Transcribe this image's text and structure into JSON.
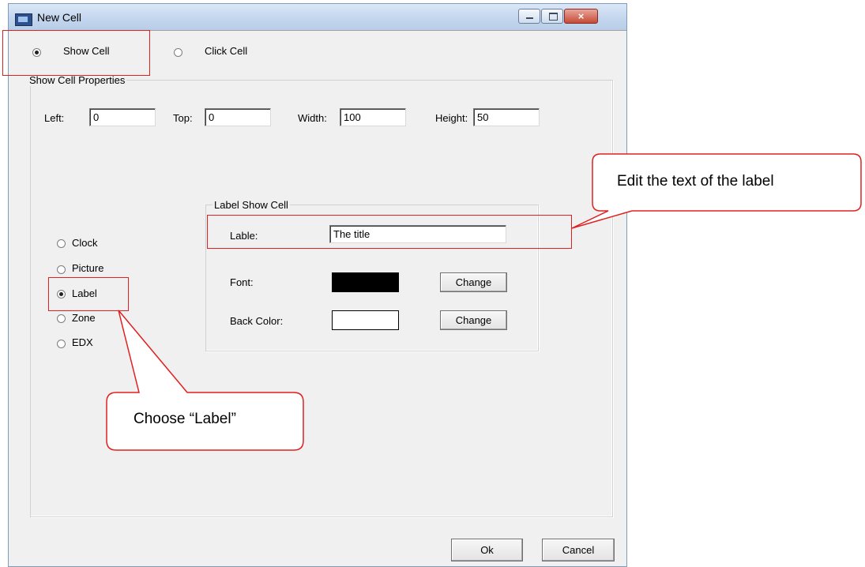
{
  "window": {
    "title": "New Cell",
    "controls": {
      "minimize": "minimize-icon",
      "maximize": "maximize-icon",
      "close": "×"
    }
  },
  "mode": {
    "options": [
      {
        "label": "Show Cell",
        "checked": true
      },
      {
        "label": "Click Cell",
        "checked": false
      }
    ]
  },
  "properties": {
    "group_label": "Show Cell Properties",
    "fields": [
      {
        "label": "Left:",
        "value": "0"
      },
      {
        "label": "Top:",
        "value": "0"
      },
      {
        "label": "Width:",
        "value": "100"
      },
      {
        "label": "Height:",
        "value": "50"
      }
    ]
  },
  "cell_types": [
    {
      "label": "Clock",
      "checked": false
    },
    {
      "label": "Picture",
      "checked": false
    },
    {
      "label": "Label",
      "checked": true
    },
    {
      "label": "Zone",
      "checked": false
    },
    {
      "label": "EDX",
      "checked": false
    }
  ],
  "label_group": {
    "title": "Label Show Cell",
    "text_label": "Lable:",
    "text_value": "The title",
    "font_label": "Font:",
    "font_color": "#000000",
    "back_label": "Back Color:",
    "back_color": "#ffffff",
    "change_label": "Change"
  },
  "footer": {
    "ok_label": "Ok",
    "cancel_label": "Cancel"
  },
  "annotations": {
    "callout_edit": "Edit the text of the label",
    "callout_choose": "Choose “Label”",
    "highlight_color": "#e02020"
  }
}
